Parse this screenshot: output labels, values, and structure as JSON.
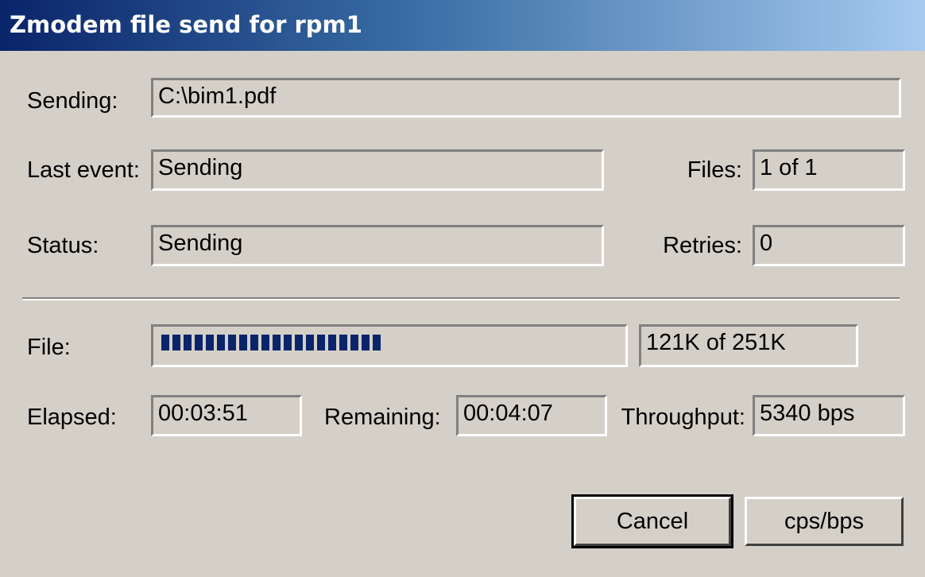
{
  "window": {
    "title": "Zmodem file send for rpm1"
  },
  "labels": {
    "sending": "Sending:",
    "last_event": "Last event:",
    "status": "Status:",
    "files": "Files:",
    "retries": "Retries:",
    "file": "File:",
    "elapsed": "Elapsed:",
    "remaining": "Remaining:",
    "throughput": "Throughput:"
  },
  "values": {
    "sending": "C:\\bim1.pdf",
    "last_event": "Sending",
    "status": "Sending",
    "files": "1 of 1",
    "retries": "0",
    "file_size": "121K of 251K",
    "elapsed": "00:03:51",
    "remaining": "00:04:07",
    "throughput": "5340 bps"
  },
  "progress": {
    "fraction": 0.482,
    "color": "#0a246a"
  },
  "buttons": {
    "cancel": "Cancel",
    "cps_bps": "cps/bps"
  }
}
